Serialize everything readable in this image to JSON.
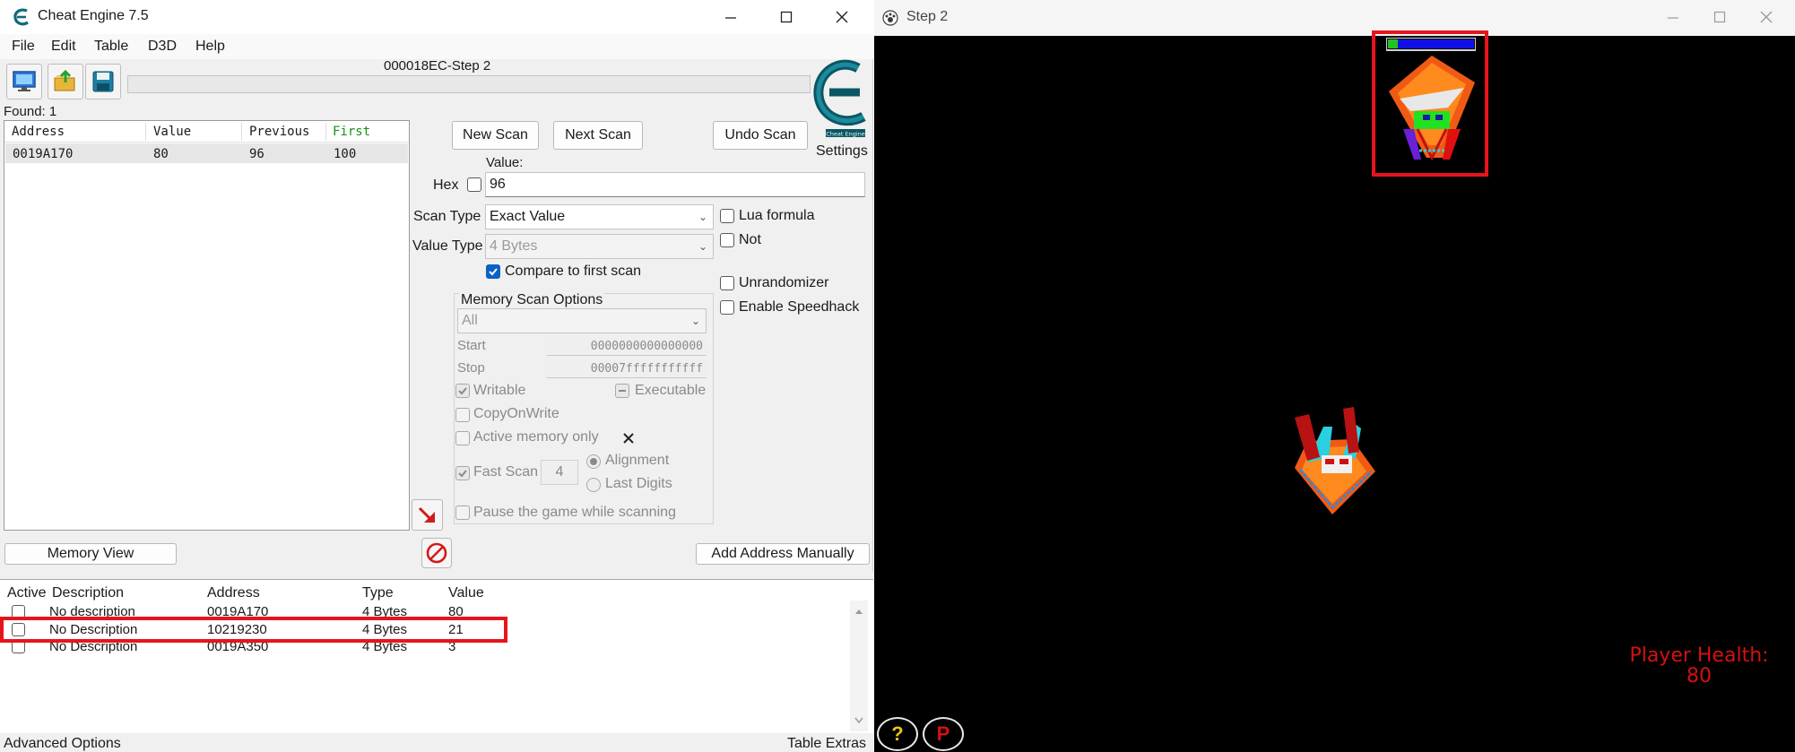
{
  "ce_window": {
    "title": "Cheat Engine 7.5",
    "process_title": "000018EC-Step 2",
    "menu": [
      "File",
      "Edit",
      "Table",
      "D3D",
      "Help"
    ],
    "settings_label": "Settings",
    "found_label": "Found: 1",
    "results": {
      "columns": [
        "Address",
        "Value",
        "Previous",
        "First"
      ],
      "rows": [
        {
          "address": "0019A170",
          "value": "80",
          "previous": "96",
          "first": "100"
        }
      ]
    },
    "buttons": {
      "new_scan": "New Scan",
      "next_scan": "Next Scan",
      "undo_scan": "Undo Scan",
      "memory_view": "Memory View",
      "add_address": "Add Address Manually"
    },
    "value_section": {
      "value_label": "Value:",
      "hex_label": "Hex",
      "value": "96",
      "scan_type_label": "Scan Type",
      "scan_type": "Exact Value",
      "value_type_label": "Value Type",
      "value_type": "4 Bytes",
      "compare_first_label": "Compare to first scan"
    },
    "right_options": {
      "lua_formula": "Lua formula",
      "not": "Not",
      "unrandomizer": "Unrandomizer",
      "speedhack": "Enable Speedhack"
    },
    "memory_options": {
      "title": "Memory Scan Options",
      "region": "All",
      "start_label": "Start",
      "start_value": "0000000000000000",
      "stop_label": "Stop",
      "stop_value": "00007fffffffffff",
      "writable": "Writable",
      "executable": "Executable",
      "copy_on_write": "CopyOnWrite",
      "active_memory_only": "Active memory only",
      "fast_scan": "Fast Scan",
      "fast_scan_value": "4",
      "alignment": "Alignment",
      "last_digits": "Last Digits",
      "pause_game": "Pause the game while scanning"
    },
    "address_table": {
      "columns": [
        "Active",
        "Description",
        "Address",
        "Type",
        "Value"
      ],
      "rows": [
        {
          "description": "No description",
          "address": "0019A170",
          "type": "4 Bytes",
          "value": "80"
        },
        {
          "description": "No Description",
          "address": "10219230",
          "type": "4 Bytes",
          "value": "21"
        },
        {
          "description": "No Description",
          "address": "0019A350",
          "type": "4 Bytes",
          "value": "3"
        }
      ]
    },
    "status": {
      "left": "Advanced Options",
      "right": "Table Extras"
    }
  },
  "game_window": {
    "title": "Step 2",
    "health_label": "Player Health:",
    "health_value": "80",
    "help_button": "?",
    "pause_button": "P"
  },
  "colors": {
    "highlight": "#e8141c",
    "health_text": "#d41111",
    "first_column": "#1a8f1a",
    "checkbox_checked": "#0a62c4"
  }
}
